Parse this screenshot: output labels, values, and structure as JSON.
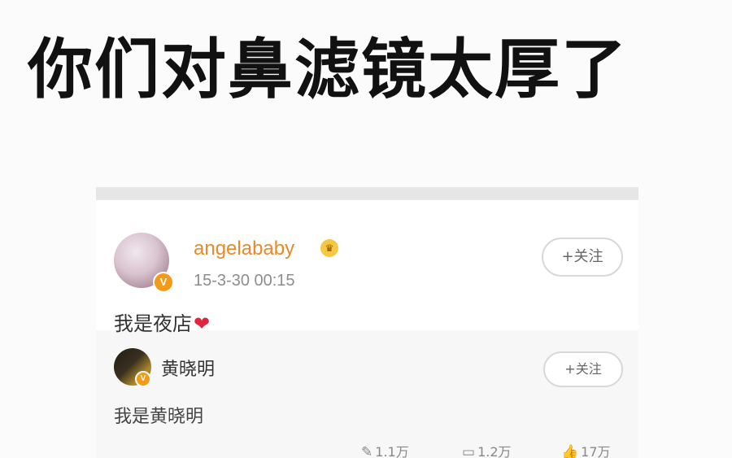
{
  "headline": "你们对鼻滤镜太厚了",
  "post": {
    "username": "angelababy",
    "verified_badge": "V",
    "vip_icon": "crown-icon",
    "timestamp": "15-3-30 00:15",
    "follow_label": "+关注",
    "content": "我是夜店",
    "content_icon": "heart-icon",
    "heart_glyph": "❤"
  },
  "reply": {
    "username": "黄晓明",
    "verified_badge": "V",
    "follow_label": "+关注",
    "content": "我是黄晓明"
  },
  "stats": {
    "repost": "1.1万",
    "comment": "1.2万",
    "like": "17万"
  },
  "colors": {
    "username": "#e8892a",
    "badge": "#f49a17",
    "heart": "#e0253e"
  }
}
